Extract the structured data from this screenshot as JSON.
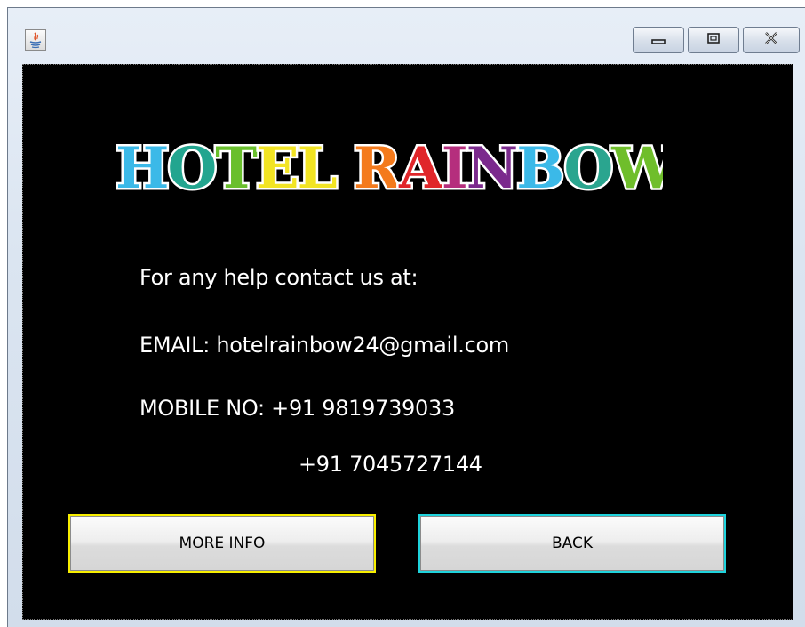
{
  "window": {
    "controls": {
      "minimize_icon": "minimize-icon",
      "maximize_icon": "maximize-icon",
      "close_icon": "close-icon"
    }
  },
  "logo": {
    "text": "HOTEL RAINBOW",
    "letter_colors": [
      "#3bb9e8",
      "#22a58f",
      "#69bf2c",
      "#f2e423",
      "#f2e423",
      " ",
      "#f47a1c",
      "#e0262a",
      "#b52e7d",
      "#7b2a8d",
      "#3bb9e8",
      "#2aa58f",
      "#6fbe2b"
    ]
  },
  "contact": {
    "help_text": "For any help contact us at:",
    "email_line": "EMAIL: hotelrainbow24@gmail.com",
    "mobile_line": "MOBILE NO: +91 9819739033",
    "mobile_line_2": "+91 7045727144"
  },
  "buttons": {
    "more_info": "MORE INFO",
    "back": "BACK"
  },
  "colors": {
    "more_info_border": "#f7ee00",
    "back_border": "#1fd3dc",
    "background": "#000000"
  }
}
